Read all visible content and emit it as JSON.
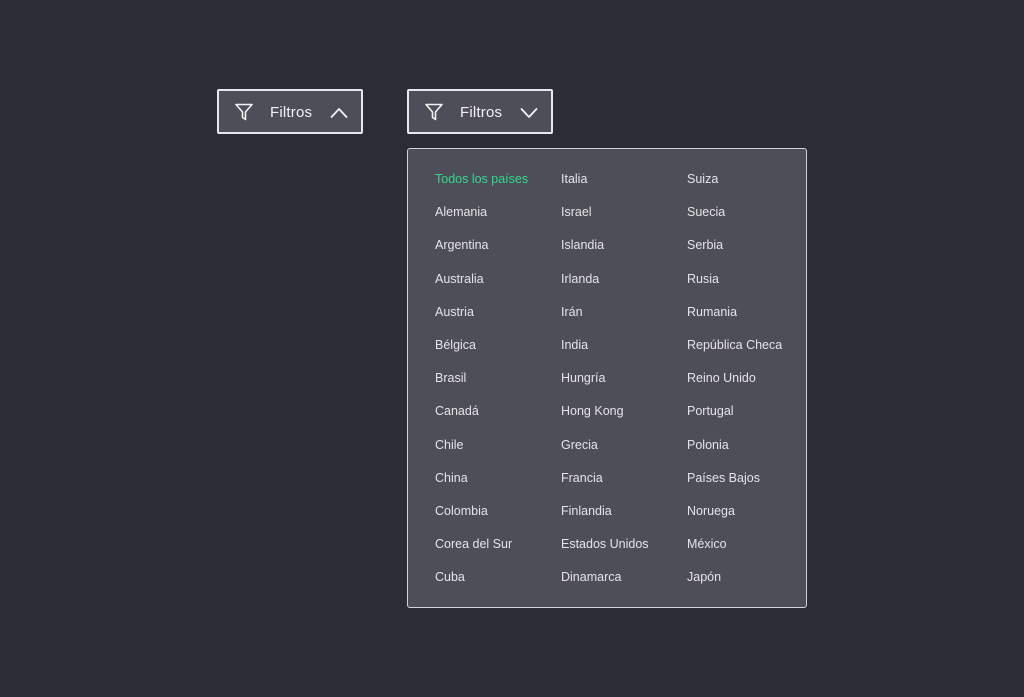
{
  "filter_collapsed": {
    "label": "Filtros",
    "icon": "funnel-icon",
    "chevron": "chevron-up-icon"
  },
  "filter_expanded": {
    "label": "Filtros",
    "icon": "funnel-icon",
    "chevron": "chevron-down-icon"
  },
  "colors": {
    "background": "#2c2c36",
    "panel": "#4e4e58",
    "selected": "#2fd98d",
    "text": "#e4e4e8"
  },
  "dropdown": {
    "selected": "Todos los países",
    "countries": [
      "Todos los países",
      "Alemania",
      "Argentina",
      "Australia",
      "Austria",
      "Bélgica",
      "Brasil",
      "Canadá",
      "Chile",
      "China",
      "Colombia",
      "Corea del Sur",
      "Cuba",
      "Italia",
      "Israel",
      "Islandia",
      "Irlanda",
      "Irán",
      "India",
      "Hungría",
      "Hong Kong",
      "Grecia",
      "Francia",
      "Finlandia",
      "Estados Unidos",
      "Dinamarca",
      "Suiza",
      "Suecia",
      "Serbia",
      "Rusia",
      "Rumania",
      "República Checa",
      "Reino Unido",
      "Portugal",
      "Polonia",
      "Países Bajos",
      "Noruega",
      "México",
      "Japón"
    ]
  }
}
